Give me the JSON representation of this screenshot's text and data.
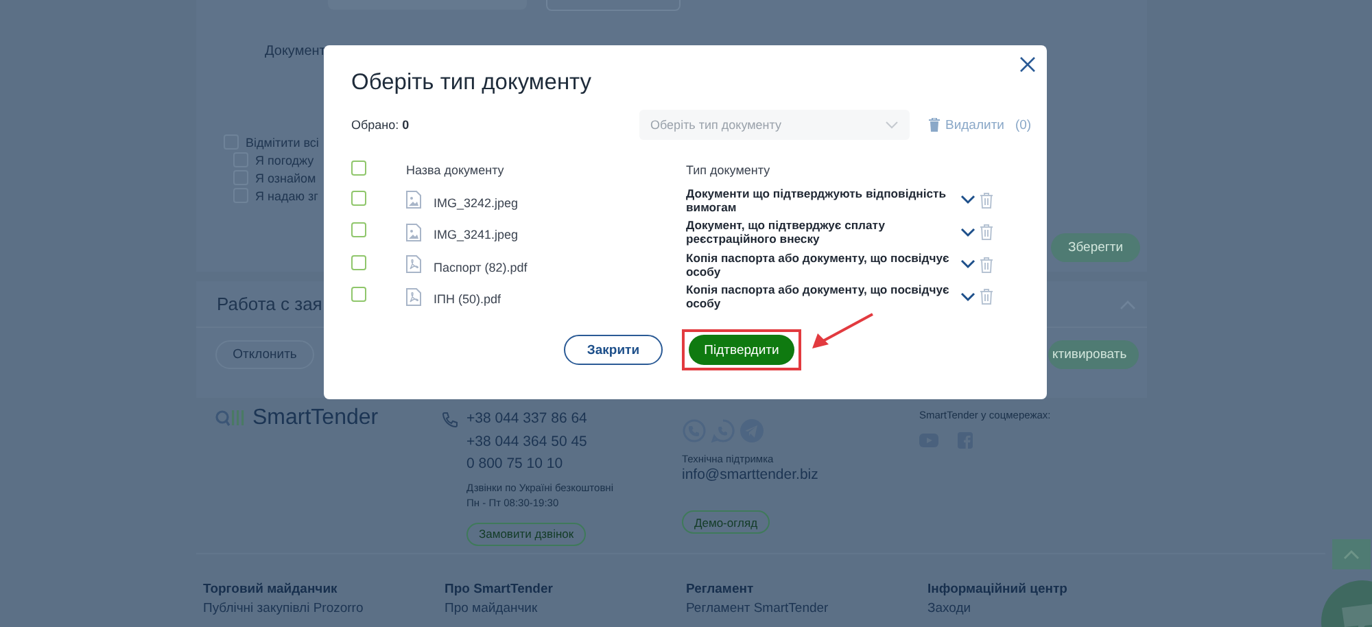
{
  "background": {
    "documents_label": "Документ",
    "select_all": {
      "label": "Відмітити всі",
      "checked": false
    },
    "agreements": [
      {
        "label": "Я погоджу",
        "checked": false
      },
      {
        "label": "Я ознайом",
        "checked": false
      },
      {
        "label": "Я надаю зг",
        "checked": false
      }
    ],
    "save_button": "Зберегти",
    "requests_panel": {
      "title": "Работа с зая",
      "buttons": [
        "Отклонить",
        "ктивировать"
      ]
    }
  },
  "footer": {
    "logo": "SmartTender",
    "phones": [
      "+38 044 337 86 64",
      "+38 044 364 50 45",
      "0 800 75 10 10"
    ],
    "call_note": "Дзвінки по Україні безкоштовні",
    "hours": "Пн - Пт 08:30-19:30",
    "call_button": "Замовити дзвінок",
    "support_label": "Технічна підтримка",
    "support_email": "info@smarttender.biz",
    "demo_button": "Демо-огляд",
    "social_label": "SmartTender у соцмережах:",
    "columns": [
      {
        "heading": "Торговий майданчик",
        "link": "Публічні закупівлі Prozorro"
      },
      {
        "heading": "Про SmartTender",
        "link": "Про майданчик"
      },
      {
        "heading": "Регламент",
        "link": "Регламент SmartTender"
      },
      {
        "heading": "Інформаційний центр",
        "link": "Заходи"
      }
    ]
  },
  "dialog": {
    "title": "Оберіть тип документу",
    "selected_count": "Обрано: **0**",
    "type_select": {
      "placeholder": "Оберіть тип документу"
    },
    "delete": {
      "label": "Видалити",
      "count": "(0)"
    },
    "select_all_checked": false,
    "columns": [
      "Назва документу",
      "Тип документу"
    ],
    "rows": [
      {
        "kind": "image",
        "name": "IMG_3242.jpeg",
        "type": "Документи що підтверджують відповідність вимогам",
        "checked": false
      },
      {
        "kind": "image",
        "name": "IMG_3241.jpeg",
        "type": "Документ, що підтверджує сплату реєстраційного внеску",
        "checked": false
      },
      {
        "kind": "pdf",
        "name": "Паспорт (82).pdf",
        "type": "Копія паспорта або документу, що посвідчує особу",
        "checked": false
      },
      {
        "kind": "pdf",
        "name": "ІПН (50).pdf",
        "type": "Копія паспорта або документу, що посвідчує особу",
        "checked": false
      }
    ],
    "buttons": {
      "close": "Закрити",
      "confirm": "Підтвердити"
    }
  }
}
